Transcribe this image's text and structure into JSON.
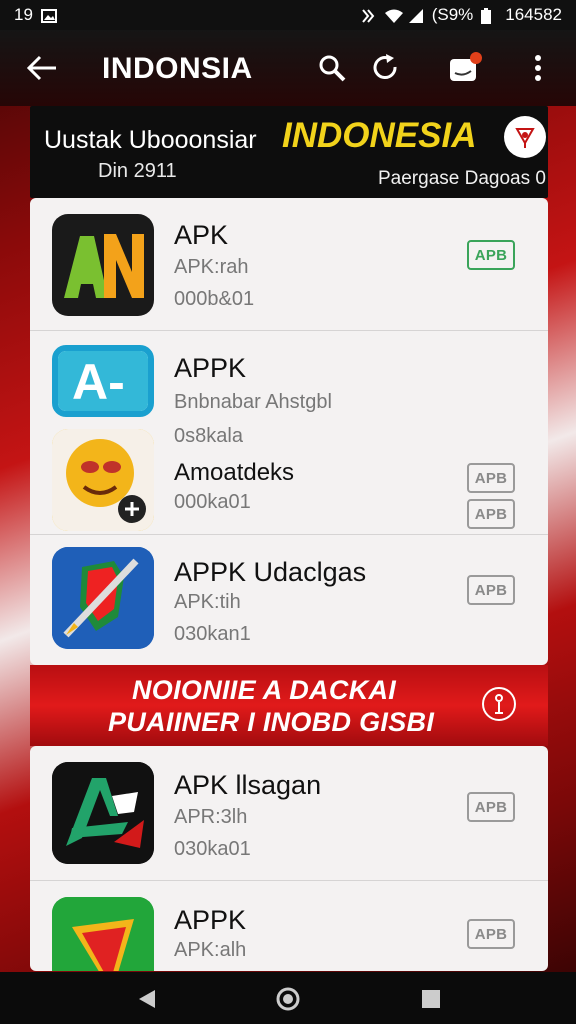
{
  "status_bar": {
    "time": "19",
    "battery_text": "(S9%",
    "clock_right": "164582"
  },
  "toolbar": {
    "title": "INDONSIA"
  },
  "banner": {
    "title": "Uustak Ubooonsiar",
    "subtitle": "Din 2911",
    "brand": "INDONESIA",
    "right_text": "Paergase Dagoas 0"
  },
  "apps": [
    {
      "name": "APK",
      "line2": "APK:rah",
      "line3": "000b&01",
      "button": "APB",
      "button_style": "green"
    },
    {
      "name": "APPK",
      "line2": "Bnbnabar Ahstgbl",
      "line3": "0s8kala",
      "button": "APB",
      "button_style": "gray"
    },
    {
      "name": "Amoatdeks",
      "line2": "",
      "line3": "000ka01",
      "button": "APB",
      "button_style": "gray"
    },
    {
      "name": "APPK Udaclgas",
      "line2": "APK:tih",
      "line3": "030kan1",
      "button": "APB",
      "button_style": "gray"
    },
    {
      "name": "APK llsagan",
      "line2": "APR:3lh",
      "line3": "030ka01",
      "button": "APB",
      "button_style": "gray"
    },
    {
      "name": "APPK",
      "line2": "APK:alh",
      "line3": "",
      "button": "APB",
      "button_style": "gray"
    }
  ],
  "promo": {
    "line1": "NOIONIIE A DACKAI",
    "line2": "PUAIINER I INOBD GISBI"
  },
  "colors": {
    "accent_red": "#e11a1a",
    "brand_yellow": "#f2d31b",
    "button_green": "#3aa45a"
  },
  "icons": {
    "status": [
      "gallery-icon",
      "nfc-icon",
      "wifi-icon",
      "signal-icon",
      "battery-icon"
    ],
    "toolbar": [
      "back-arrow-icon",
      "search-icon",
      "refresh-icon",
      "inbox-icon",
      "more-vert-icon"
    ],
    "nav": [
      "nav-back-icon",
      "nav-home-icon",
      "nav-recents-icon"
    ]
  }
}
